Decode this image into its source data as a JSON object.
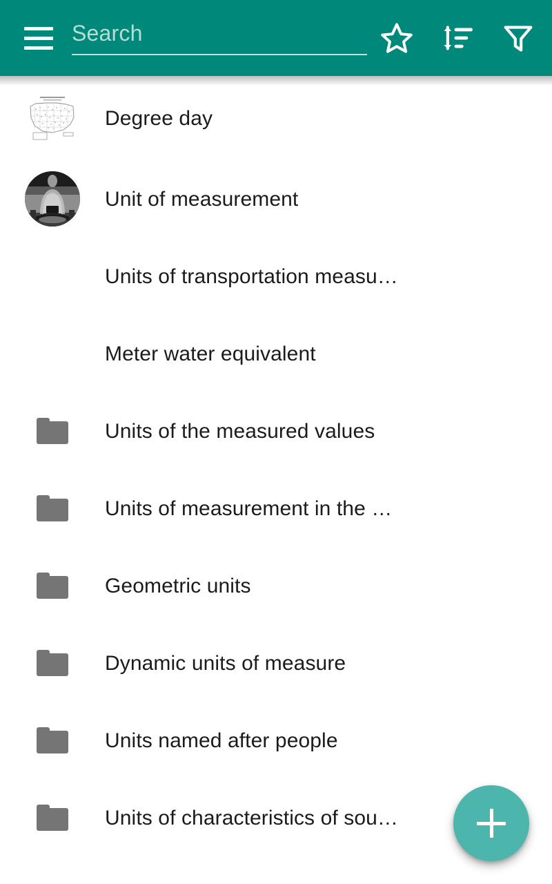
{
  "app_bar": {
    "menu_icon": "hamburger-menu-icon",
    "search": {
      "placeholder": "Search",
      "value": ""
    },
    "actions": [
      {
        "name": "favorites-button",
        "icon": "star-outline-icon",
        "label": "Favorites"
      },
      {
        "name": "sort-button",
        "icon": "sort-icon",
        "label": "Sort"
      },
      {
        "name": "filter-button",
        "icon": "filter-funnel-icon",
        "label": "Filter"
      }
    ],
    "colors": {
      "background": "#00897b",
      "icon": "#ffffff",
      "placeholder": "#b4ddd6",
      "underline": "#bfe1dc"
    }
  },
  "list": {
    "items": [
      {
        "label": "Degree day",
        "lead": "thumbnail-map"
      },
      {
        "label": "Unit of measurement",
        "lead": "thumbnail-circle-photo"
      },
      {
        "label": "Units of transportation measu…",
        "lead": "none"
      },
      {
        "label": "Meter water equivalent",
        "lead": "none"
      },
      {
        "label": "Units of the measured values",
        "lead": "folder-icon"
      },
      {
        "label": "Units of measurement in the …",
        "lead": "folder-icon"
      },
      {
        "label": "Geometric units",
        "lead": "folder-icon"
      },
      {
        "label": "Dynamic units of measure",
        "lead": "folder-icon"
      },
      {
        "label": "Units named after people",
        "lead": "folder-icon"
      },
      {
        "label": "Units of characteristics of sou…",
        "lead": "folder-icon"
      }
    ],
    "colors": {
      "text": "#1b1b1b",
      "folder": "#757575",
      "background": "#ffffff"
    }
  },
  "fab": {
    "icon": "plus-icon",
    "label": "+",
    "color": "#4db6ac"
  }
}
